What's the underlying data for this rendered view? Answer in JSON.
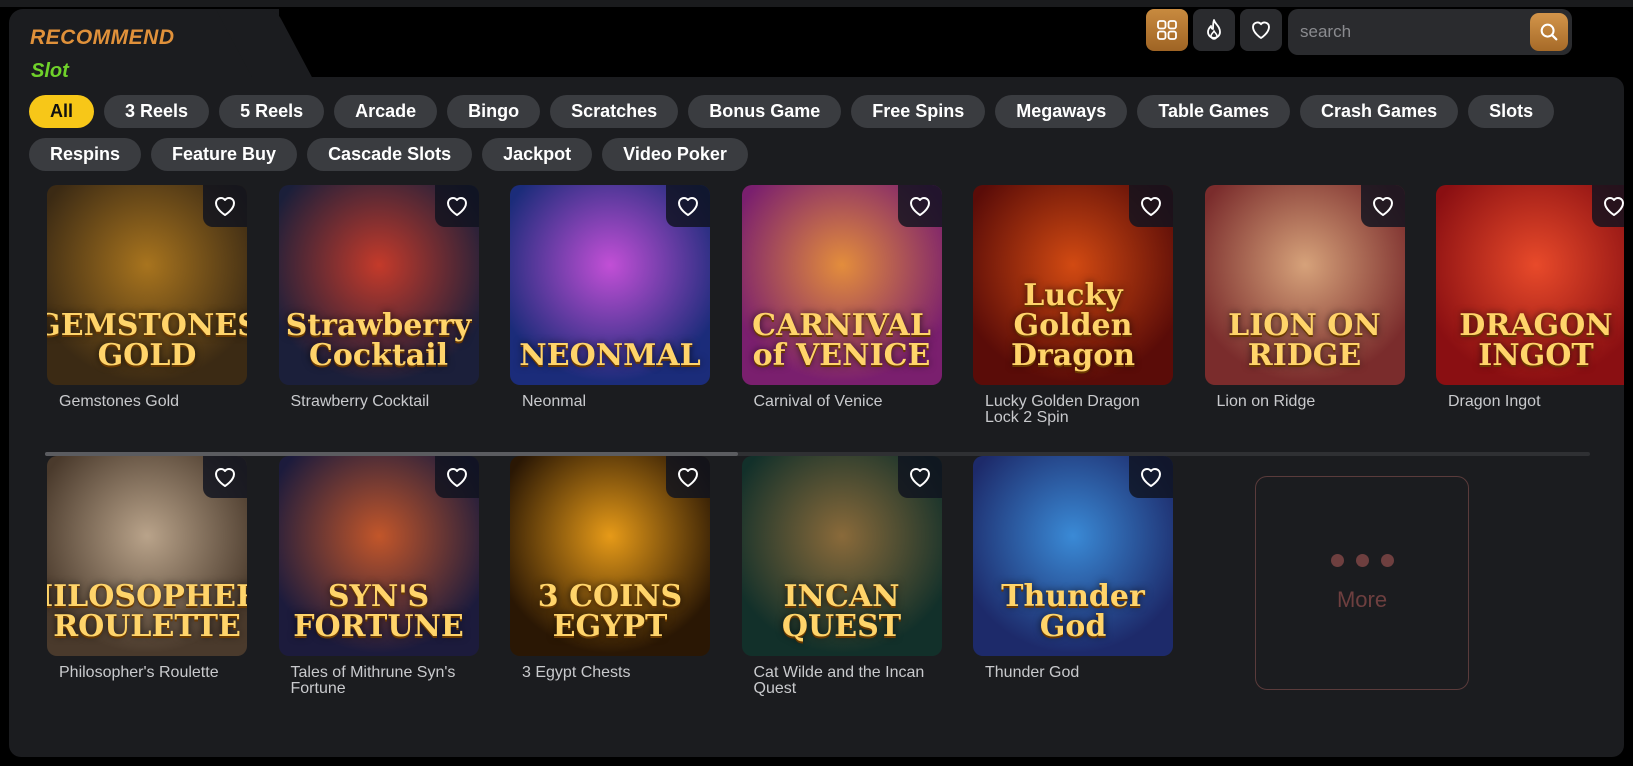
{
  "header": {
    "title": "RECOMMEND",
    "subtitle": "Slot"
  },
  "toolbar": {
    "icons": [
      "grid-icon",
      "flame-icon",
      "heart-icon"
    ],
    "search_placeholder": "search",
    "accent": "#c88a3f"
  },
  "categories": {
    "row1": [
      "All",
      "3 Reels",
      "5 Reels",
      "Arcade",
      "Bingo",
      "Scratches",
      "Bonus Game",
      "Free Spins",
      "Megaways",
      "Table Games",
      "Crash Games",
      "Slots"
    ],
    "row2": [
      "Respins",
      "Feature Buy",
      "Cascade Slots",
      "Jackpot",
      "Video Poker"
    ],
    "active": "All"
  },
  "games_row1": [
    {
      "name": "Gemstones Gold",
      "art": "GEMSTONES GOLD",
      "bg": "#3b2a14",
      "bg2": "#a8741e"
    },
    {
      "name": "Strawberry Cocktail",
      "art": "Strawberry Cocktail",
      "bg": "#1b1f3a",
      "bg2": "#c43a2a"
    },
    {
      "name": "Neonmal",
      "art": "NEONMAL",
      "bg": "#1b2c7a",
      "bg2": "#c24fd6"
    },
    {
      "name": "Carnival of Venice",
      "art": "CARNIVAL of VENICE",
      "bg": "#7a1f6e",
      "bg2": "#e38d3c"
    },
    {
      "name": "Lucky Golden Dragon Lock 2 Spin",
      "art": "Lucky Golden Dragon",
      "bg": "#5a0c08",
      "bg2": "#d24a12"
    },
    {
      "name": "Lion on Ridge",
      "art": "LION ON RIDGE",
      "bg": "#7a2c2c",
      "bg2": "#d6a27a"
    },
    {
      "name": "Dragon Ingot",
      "art": "DRAGON INGOT",
      "bg": "#8a0f12",
      "bg2": "#e84a2a"
    }
  ],
  "games_row2": [
    {
      "name": "Philosopher's Roulette",
      "art": "PHILOSOPHER'S ROULETTE",
      "bg": "#4a3a2c",
      "bg2": "#b9a38a"
    },
    {
      "name": "Tales of Mithrune Syn's Fortune",
      "art": "SYN'S FORTUNE",
      "bg": "#1c1b3c",
      "bg2": "#c2562a"
    },
    {
      "name": "3 Egypt Chests",
      "art": "3 COINS EGYPT",
      "bg": "#2a1704",
      "bg2": "#e69a18"
    },
    {
      "name": "Cat Wilde and the Incan Quest",
      "art": "INCAN QUEST",
      "bg": "#12302a",
      "bg2": "#8a6a3a"
    },
    {
      "name": "Thunder God",
      "art": "Thunder God",
      "bg": "#1d2a6a",
      "bg2": "#3a8ad6"
    }
  ],
  "more": {
    "label": "More"
  }
}
